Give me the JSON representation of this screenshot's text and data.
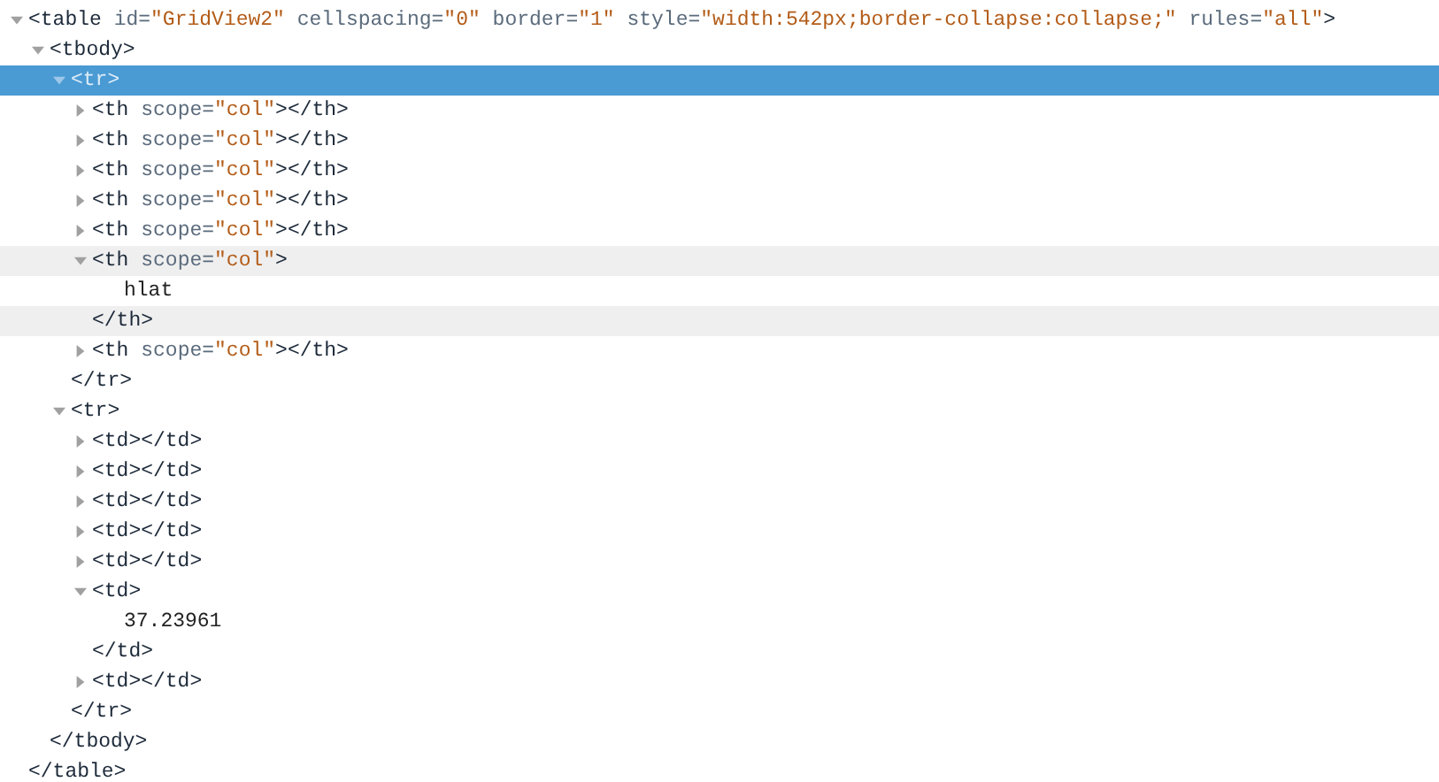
{
  "dom_tree": [
    {
      "kind": "element",
      "expanded": true,
      "selected": false,
      "highlighted": false,
      "open": [
        {
          "kind": "tag",
          "text": "<table"
        },
        {
          "kind": "attr",
          "text": " id="
        },
        {
          "kind": "value",
          "text": "\"GridView2\""
        },
        {
          "kind": "attr",
          "text": " cellspacing="
        },
        {
          "kind": "value",
          "text": "\"0\""
        },
        {
          "kind": "attr",
          "text": " border="
        },
        {
          "kind": "value",
          "text": "\"1\""
        },
        {
          "kind": "attr",
          "text": " style="
        },
        {
          "kind": "value",
          "text": "\"width:542px;border-collapse:collapse;\""
        },
        {
          "kind": "attr",
          "text": " rules="
        },
        {
          "kind": "value",
          "text": "\"all\""
        },
        {
          "kind": "tag",
          "text": ">"
        }
      ],
      "close": [
        {
          "kind": "tag",
          "text": "</table>"
        }
      ],
      "children": [
        {
          "kind": "element",
          "expanded": true,
          "selected": false,
          "highlighted": false,
          "open": [
            {
              "kind": "tag",
              "text": "<tbody>"
            }
          ],
          "close": [
            {
              "kind": "tag",
              "text": "</tbody>"
            }
          ],
          "children": [
            {
              "kind": "element",
              "expanded": true,
              "selected": true,
              "highlighted": false,
              "open": [
                {
                  "kind": "tag",
                  "text": "<tr>"
                }
              ],
              "close": [
                {
                  "kind": "tag",
                  "text": "</tr>"
                }
              ],
              "children": [
                {
                  "kind": "element",
                  "expanded": false,
                  "selected": false,
                  "highlighted": false,
                  "open": [
                    {
                      "kind": "tag",
                      "text": "<th"
                    },
                    {
                      "kind": "attr",
                      "text": " scope="
                    },
                    {
                      "kind": "value",
                      "text": "\"col\""
                    },
                    {
                      "kind": "tag",
                      "text": "></th>"
                    }
                  ]
                },
                {
                  "kind": "element",
                  "expanded": false,
                  "selected": false,
                  "highlighted": false,
                  "open": [
                    {
                      "kind": "tag",
                      "text": "<th"
                    },
                    {
                      "kind": "attr",
                      "text": " scope="
                    },
                    {
                      "kind": "value",
                      "text": "\"col\""
                    },
                    {
                      "kind": "tag",
                      "text": "></th>"
                    }
                  ]
                },
                {
                  "kind": "element",
                  "expanded": false,
                  "selected": false,
                  "highlighted": false,
                  "open": [
                    {
                      "kind": "tag",
                      "text": "<th"
                    },
                    {
                      "kind": "attr",
                      "text": " scope="
                    },
                    {
                      "kind": "value",
                      "text": "\"col\""
                    },
                    {
                      "kind": "tag",
                      "text": "></th>"
                    }
                  ]
                },
                {
                  "kind": "element",
                  "expanded": false,
                  "selected": false,
                  "highlighted": false,
                  "open": [
                    {
                      "kind": "tag",
                      "text": "<th"
                    },
                    {
                      "kind": "attr",
                      "text": " scope="
                    },
                    {
                      "kind": "value",
                      "text": "\"col\""
                    },
                    {
                      "kind": "tag",
                      "text": "></th>"
                    }
                  ]
                },
                {
                  "kind": "element",
                  "expanded": false,
                  "selected": false,
                  "highlighted": false,
                  "open": [
                    {
                      "kind": "tag",
                      "text": "<th"
                    },
                    {
                      "kind": "attr",
                      "text": " scope="
                    },
                    {
                      "kind": "value",
                      "text": "\"col\""
                    },
                    {
                      "kind": "tag",
                      "text": "></th>"
                    }
                  ]
                },
                {
                  "kind": "element",
                  "expanded": true,
                  "selected": false,
                  "highlighted": true,
                  "open": [
                    {
                      "kind": "tag",
                      "text": "<th"
                    },
                    {
                      "kind": "attr",
                      "text": " scope="
                    },
                    {
                      "kind": "value",
                      "text": "\"col\""
                    },
                    {
                      "kind": "tag",
                      "text": ">"
                    }
                  ],
                  "close": [
                    {
                      "kind": "tag",
                      "text": "</th>"
                    }
                  ],
                  "children": [
                    {
                      "kind": "text",
                      "text": "hlat"
                    }
                  ]
                },
                {
                  "kind": "element",
                  "expanded": false,
                  "selected": false,
                  "highlighted": false,
                  "open": [
                    {
                      "kind": "tag",
                      "text": "<th"
                    },
                    {
                      "kind": "attr",
                      "text": " scope="
                    },
                    {
                      "kind": "value",
                      "text": "\"col\""
                    },
                    {
                      "kind": "tag",
                      "text": "></th>"
                    }
                  ]
                }
              ]
            },
            {
              "kind": "element",
              "expanded": true,
              "selected": false,
              "highlighted": false,
              "open": [
                {
                  "kind": "tag",
                  "text": "<tr>"
                }
              ],
              "close": [
                {
                  "kind": "tag",
                  "text": "</tr>"
                }
              ],
              "children": [
                {
                  "kind": "element",
                  "expanded": false,
                  "selected": false,
                  "highlighted": false,
                  "open": [
                    {
                      "kind": "tag",
                      "text": "<td></td>"
                    }
                  ]
                },
                {
                  "kind": "element",
                  "expanded": false,
                  "selected": false,
                  "highlighted": false,
                  "open": [
                    {
                      "kind": "tag",
                      "text": "<td></td>"
                    }
                  ]
                },
                {
                  "kind": "element",
                  "expanded": false,
                  "selected": false,
                  "highlighted": false,
                  "open": [
                    {
                      "kind": "tag",
                      "text": "<td></td>"
                    }
                  ]
                },
                {
                  "kind": "element",
                  "expanded": false,
                  "selected": false,
                  "highlighted": false,
                  "open": [
                    {
                      "kind": "tag",
                      "text": "<td></td>"
                    }
                  ]
                },
                {
                  "kind": "element",
                  "expanded": false,
                  "selected": false,
                  "highlighted": false,
                  "open": [
                    {
                      "kind": "tag",
                      "text": "<td></td>"
                    }
                  ]
                },
                {
                  "kind": "element",
                  "expanded": true,
                  "selected": false,
                  "highlighted": false,
                  "open": [
                    {
                      "kind": "tag",
                      "text": "<td>"
                    }
                  ],
                  "close": [
                    {
                      "kind": "tag",
                      "text": "</td>"
                    }
                  ],
                  "children": [
                    {
                      "kind": "text",
                      "text": "37.23961"
                    }
                  ]
                },
                {
                  "kind": "element",
                  "expanded": false,
                  "selected": false,
                  "highlighted": false,
                  "open": [
                    {
                      "kind": "tag",
                      "text": "<td></td>"
                    }
                  ]
                }
              ]
            }
          ]
        }
      ]
    }
  ]
}
